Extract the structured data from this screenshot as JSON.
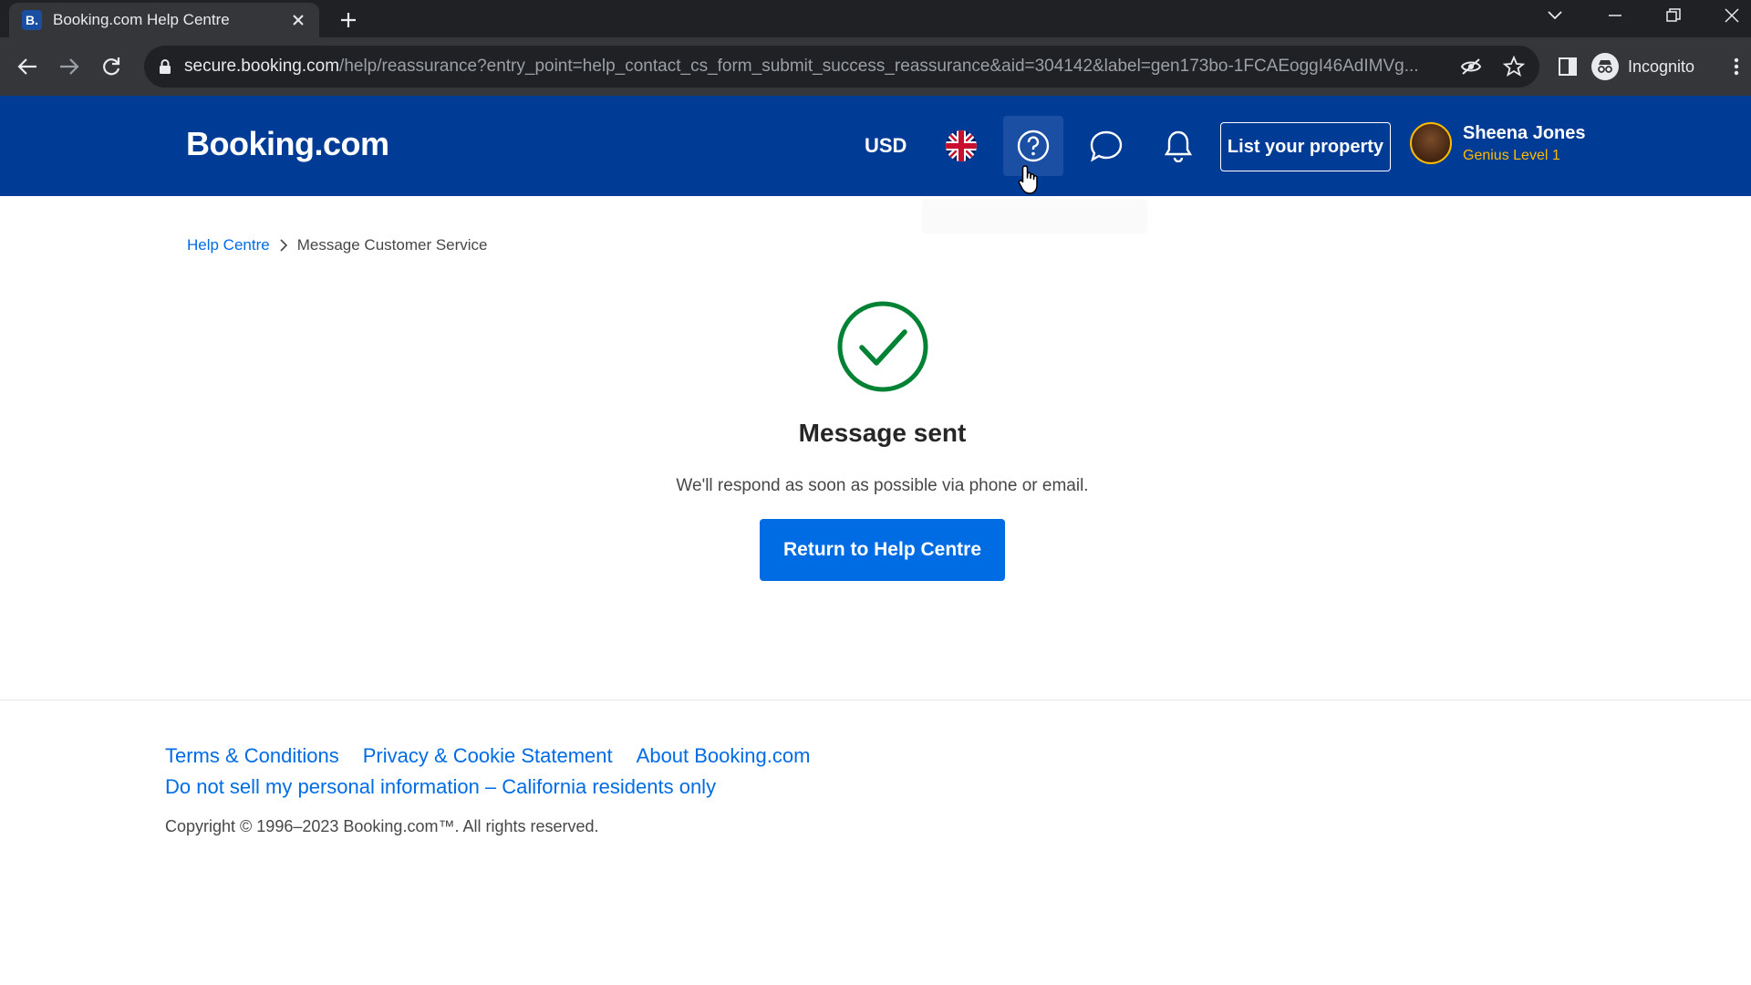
{
  "browser": {
    "tab_favicon": "B.",
    "tab_title": "Booking.com Help Centre",
    "url_host": "secure.booking.com",
    "url_path": "/help/reassurance?entry_point=help_contact_cs_form_submit_success_reassurance&aid=304142&label=gen173bo-1FCAEoggI46AdIMVg...",
    "incognito_label": "Incognito"
  },
  "header": {
    "logo": "Booking.com",
    "currency": "USD",
    "list_property": "List your property",
    "user_name": "Sheena Jones",
    "user_level": "Genius Level 1",
    "brand_color": "#003b95",
    "genius_color": "#febb02"
  },
  "breadcrumb": {
    "home": "Help Centre",
    "current": "Message Customer Service"
  },
  "success": {
    "title": "Message sent",
    "text": "We'll respond as soon as possible via phone or email.",
    "button": "Return to Help Centre",
    "check_color": "#008234",
    "button_color": "#006ce4"
  },
  "footer": {
    "links": [
      "Terms & Conditions",
      "Privacy & Cookie Statement",
      "About Booking.com"
    ],
    "ccpa": "Do not sell my personal information – California residents only",
    "copyright": "Copyright © 1996–2023 Booking.com™. All rights reserved."
  },
  "icons": [
    "uk-flag-icon",
    "help-icon",
    "chat-icon",
    "bell-icon",
    "lock-icon",
    "star-icon",
    "eye-off-icon",
    "side-panel-icon",
    "incognito-icon",
    "check-circle-icon"
  ]
}
